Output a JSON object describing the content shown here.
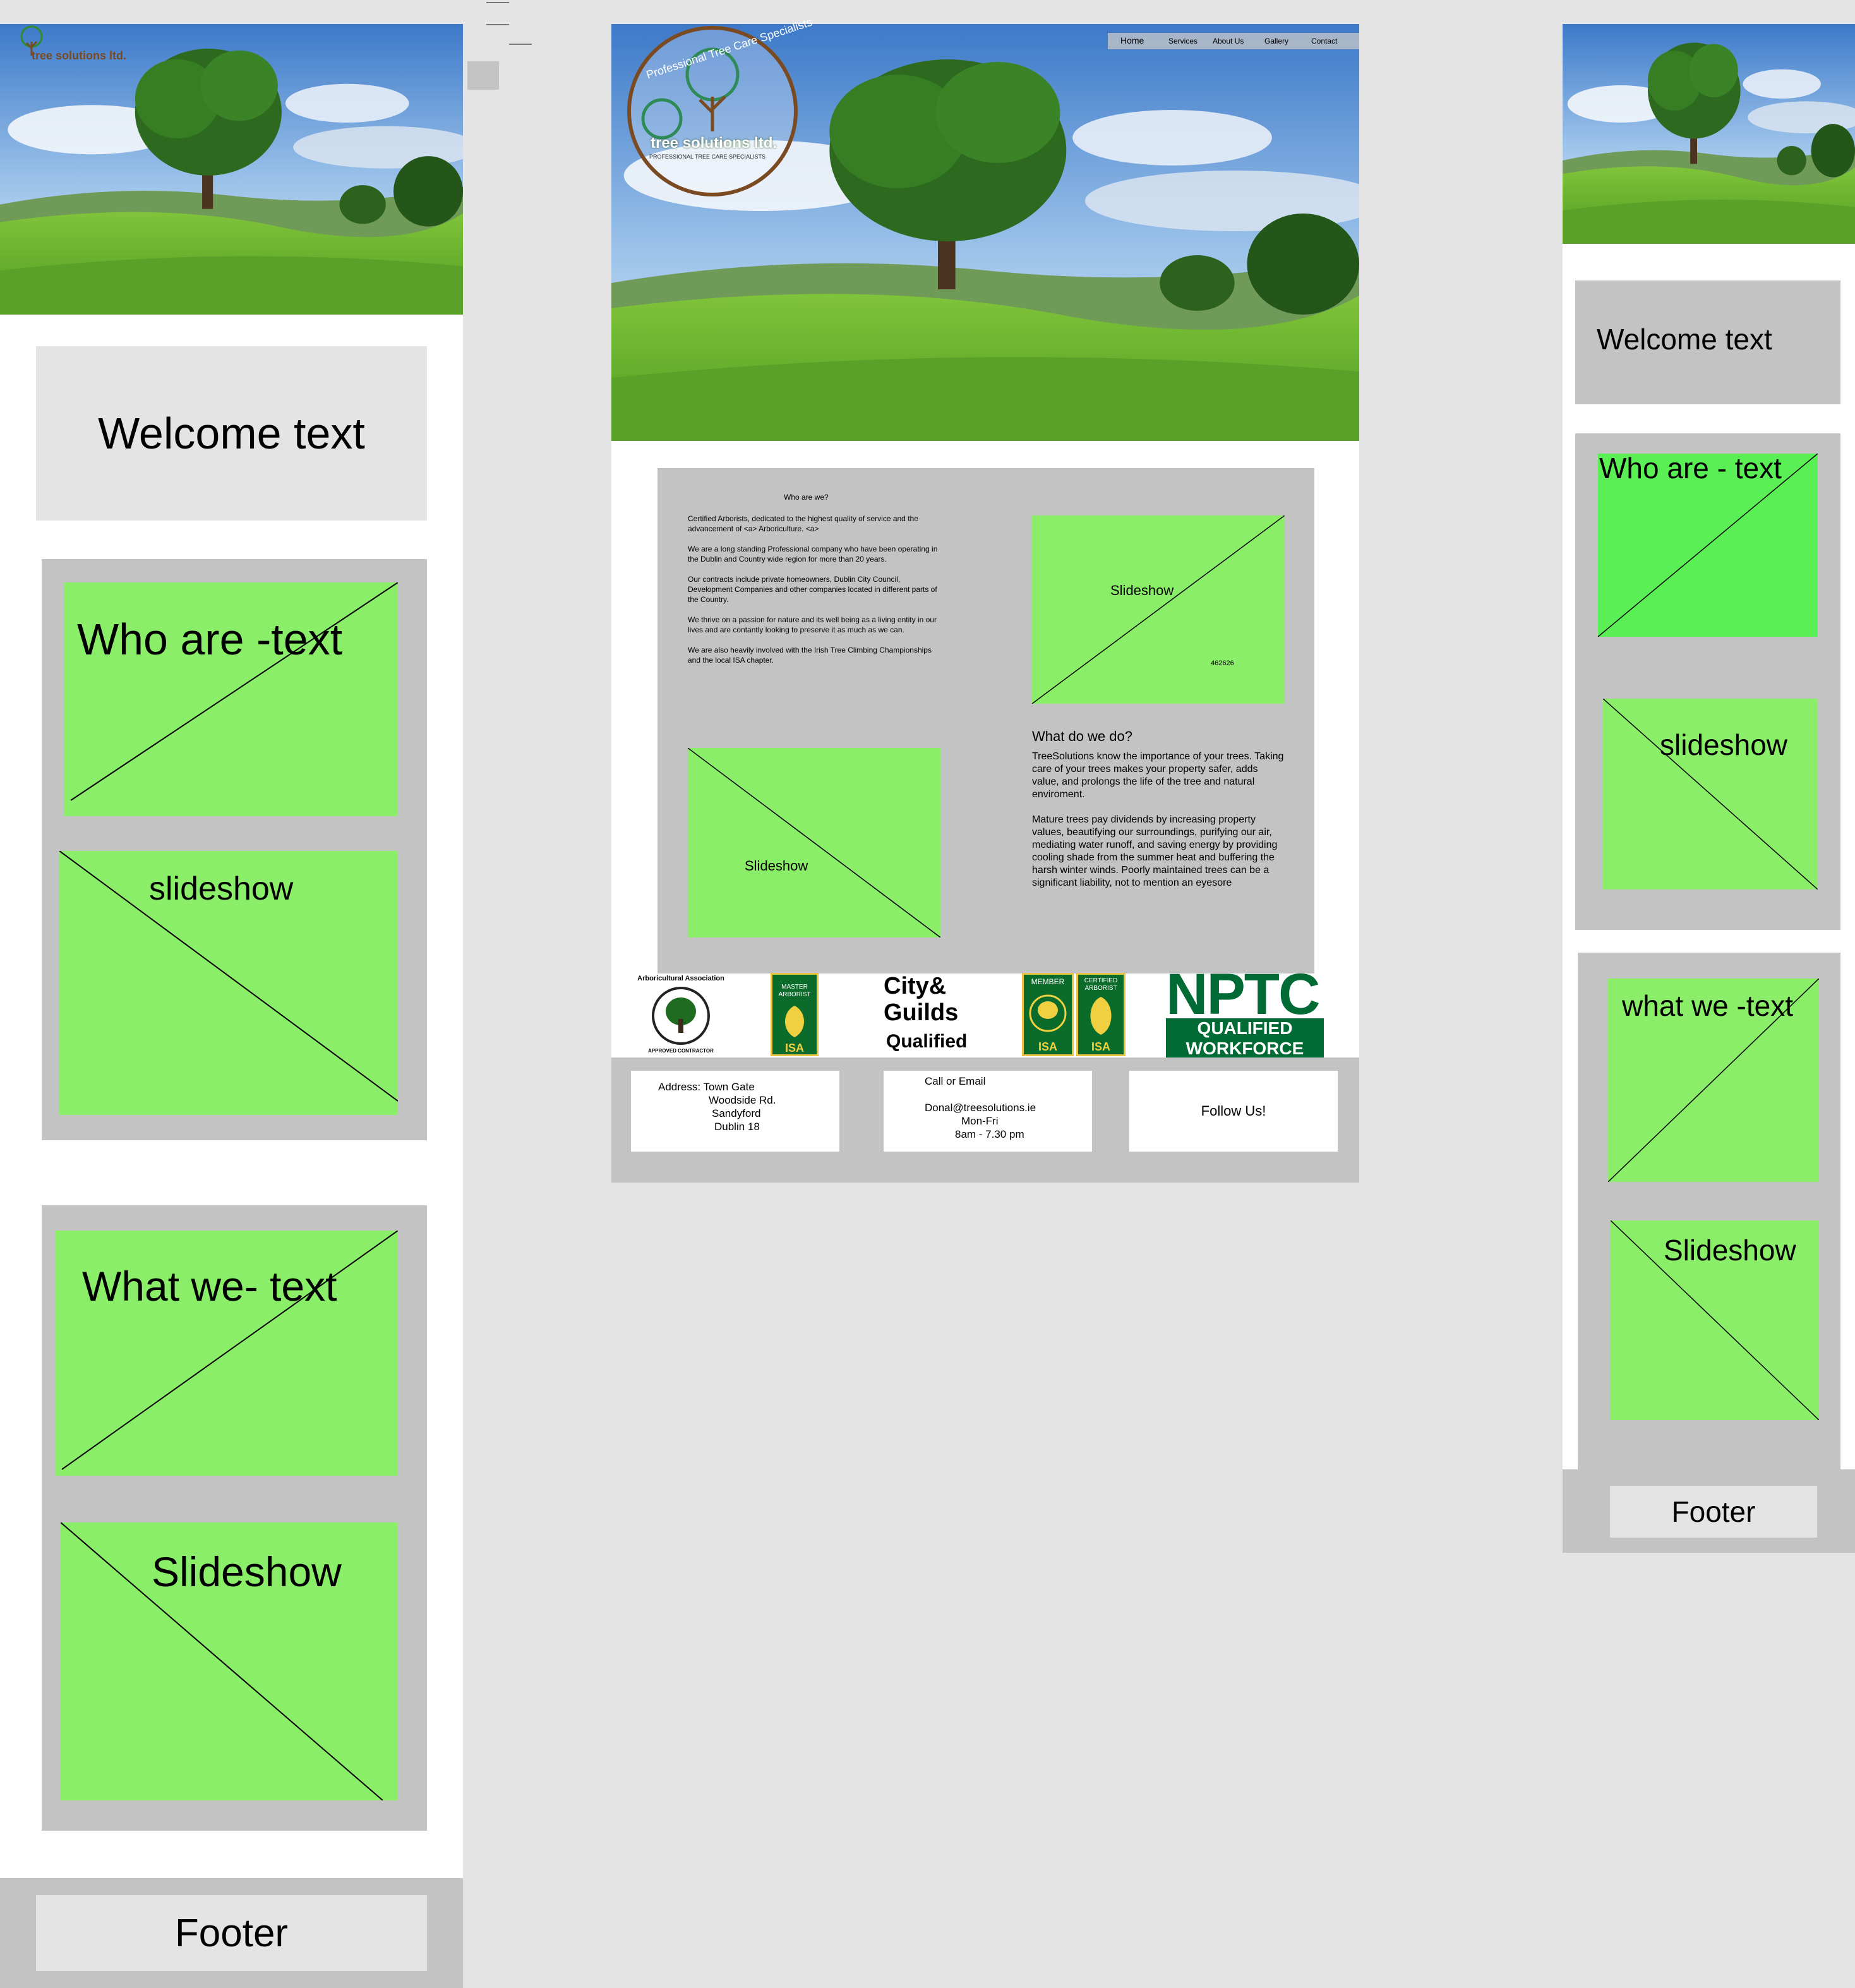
{
  "brand": {
    "name": "tree solutions ltd.",
    "tagline": "Professional Tree Care Specialists",
    "tagline_small": "PROFESSIONAL TREE CARE SPECIALISTS"
  },
  "mobile": {
    "welcome": "Welcome text",
    "who": "Who are -text",
    "slideshow1": "slideshow",
    "what": "What we- text",
    "slideshow2": "Slideshow",
    "footer": "Footer"
  },
  "desktop": {
    "nav": [
      "Home",
      "Services",
      "About Us",
      "Gallery",
      "Contact"
    ],
    "who_heading": "Who are we?",
    "who_paragraphs": [
      "Certified Arborists, dedicated to the highest quality of service and the advancement of <a> Arboriculture. <a>",
      "We are a long standing Professional company who have been operating in the Dublin and Country wide region for more than 20 years.",
      "Our contracts include private homeowners, Dublin City Council, Development Companies and other companies located in different parts of the Country.",
      "We thrive on a passion for nature and its well being as a living entity in our lives and are contantly looking to preserve it as much as we can.",
      "We are also heavily involved with the Irish Tree Climbing Championships and the local ISA chapter."
    ],
    "slideshow_top": "Slideshow",
    "slideshow_top_code": "462626",
    "slideshow_bottom": "Slideshow",
    "what_heading": "What do we do?",
    "what_paragraphs": [
      "TreeSolutions know the importance of your trees. Taking care of your trees makes your property safer, adds value, and prolongs the life of the tree and natural enviroment.",
      "Mature trees pay dividends by increasing property values, beautifying our surroundings, purifying our air, mediating water runoff, and saving energy by providing cooling shade from the summer heat and buffering the harsh winter winds. Poorly maintained trees can be a significant liability, not to mention an eyesore"
    ],
    "logos": {
      "arb": "Arboricultural Association",
      "arb_sub": "APPROVED CONTRACTOR",
      "isa_master": "MASTER ARBORIST",
      "isa": "ISA",
      "cg1": "City&",
      "cg2": "Guilds",
      "cg3": "Qualified",
      "isa_member": "MEMBER",
      "isa_cert": "CERTIFIED ARBORIST",
      "nptc": "NPTC",
      "nptc_sub1": "QUALIFIED",
      "nptc_sub2": "WORKFORCE"
    },
    "footer": {
      "address_label": "Address: Town Gate",
      "address_lines": [
        "Woodside Rd.",
        "Sandyford",
        "Dublin 18"
      ],
      "contact_label": "Call or Email",
      "email": "Donal@treesolutions.ie",
      "days": "Mon-Fri",
      "hours": "8am - 7.30 pm",
      "follow": "Follow Us!"
    }
  },
  "tablet": {
    "welcome": "Welcome text",
    "who": "Who are - text",
    "slideshow1": "slideshow",
    "what": "what we -text",
    "slideshow2": "Slideshow",
    "footer": "Footer"
  },
  "colors": {
    "panel_gray": "#c3c3c3",
    "canvas": "#e4e4e4",
    "placeholder_green": "#8aee68",
    "placeholder_green_bright": "#5aef55",
    "logo_brown": "#7a4a22",
    "nptc_green": "#006b35"
  }
}
